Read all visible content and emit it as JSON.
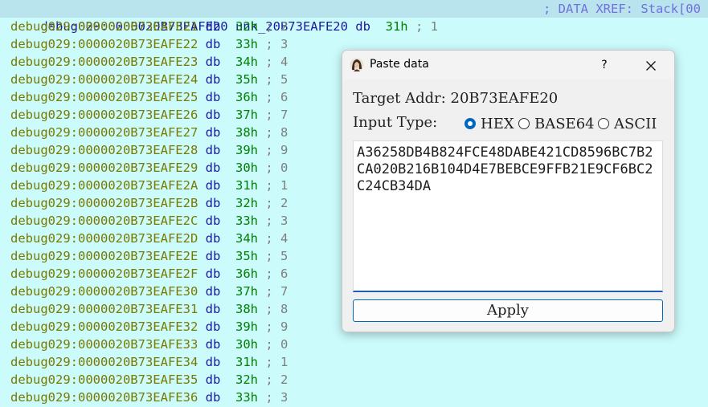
{
  "disasm": {
    "first_line": {
      "addr": "debug029:0000020B73EAFE20",
      "name": "unk_20B73EAFE20",
      "kw": "db",
      "val": "31h",
      "cmt": "; 1",
      "xref": "; DATA XREF: Stack[00"
    },
    "lines": [
      {
        "addr": "debug029:0000020B73EAFE21",
        "kw": "db",
        "val": "32h",
        "cmt": "; 2"
      },
      {
        "addr": "debug029:0000020B73EAFE22",
        "kw": "db",
        "val": "33h",
        "cmt": "; 3"
      },
      {
        "addr": "debug029:0000020B73EAFE23",
        "kw": "db",
        "val": "34h",
        "cmt": "; 4"
      },
      {
        "addr": "debug029:0000020B73EAFE24",
        "kw": "db",
        "val": "35h",
        "cmt": "; 5"
      },
      {
        "addr": "debug029:0000020B73EAFE25",
        "kw": "db",
        "val": "36h",
        "cmt": "; 6"
      },
      {
        "addr": "debug029:0000020B73EAFE26",
        "kw": "db",
        "val": "37h",
        "cmt": "; 7"
      },
      {
        "addr": "debug029:0000020B73EAFE27",
        "kw": "db",
        "val": "38h",
        "cmt": "; 8"
      },
      {
        "addr": "debug029:0000020B73EAFE28",
        "kw": "db",
        "val": "39h",
        "cmt": "; 9"
      },
      {
        "addr": "debug029:0000020B73EAFE29",
        "kw": "db",
        "val": "30h",
        "cmt": "; 0"
      },
      {
        "addr": "debug029:0000020B73EAFE2A",
        "kw": "db",
        "val": "31h",
        "cmt": "; 1"
      },
      {
        "addr": "debug029:0000020B73EAFE2B",
        "kw": "db",
        "val": "32h",
        "cmt": "; 2"
      },
      {
        "addr": "debug029:0000020B73EAFE2C",
        "kw": "db",
        "val": "33h",
        "cmt": "; 3"
      },
      {
        "addr": "debug029:0000020B73EAFE2D",
        "kw": "db",
        "val": "34h",
        "cmt": "; 4"
      },
      {
        "addr": "debug029:0000020B73EAFE2E",
        "kw": "db",
        "val": "35h",
        "cmt": "; 5"
      },
      {
        "addr": "debug029:0000020B73EAFE2F",
        "kw": "db",
        "val": "36h",
        "cmt": "; 6"
      },
      {
        "addr": "debug029:0000020B73EAFE30",
        "kw": "db",
        "val": "37h",
        "cmt": "; 7"
      },
      {
        "addr": "debug029:0000020B73EAFE31",
        "kw": "db",
        "val": "38h",
        "cmt": "; 8"
      },
      {
        "addr": "debug029:0000020B73EAFE32",
        "kw": "db",
        "val": "39h",
        "cmt": "; 9"
      },
      {
        "addr": "debug029:0000020B73EAFE33",
        "kw": "db",
        "val": "30h",
        "cmt": "; 0"
      },
      {
        "addr": "debug029:0000020B73EAFE34",
        "kw": "db",
        "val": "31h",
        "cmt": "; 1"
      },
      {
        "addr": "debug029:0000020B73EAFE35",
        "kw": "db",
        "val": "32h",
        "cmt": "; 2"
      },
      {
        "addr": "debug029:0000020B73EAFE36",
        "kw": "db",
        "val": "33h",
        "cmt": "; 3"
      }
    ]
  },
  "dialog": {
    "title": "Paste data",
    "help_label": "?",
    "app_icon": "portrait-icon",
    "close_icon": "close-icon",
    "target_addr_label": "Target Addr:",
    "target_addr_value": "20B73EAFE20",
    "input_type_label": "Input Type:",
    "input_types": [
      "HEX",
      "BASE64",
      "ASCII"
    ],
    "selected_input_type": "HEX",
    "data_text": "A36258DB4B824FCE48DABE421CD8596BC7B2CA020B216B104D4E7BEBCE9FFB21E9CF6BC2C24CB34DA",
    "apply_label": "Apply"
  },
  "colors": {
    "background": "#ccfbfb",
    "highlight_row": "#b9e4ee",
    "accent": "#0067c0"
  }
}
